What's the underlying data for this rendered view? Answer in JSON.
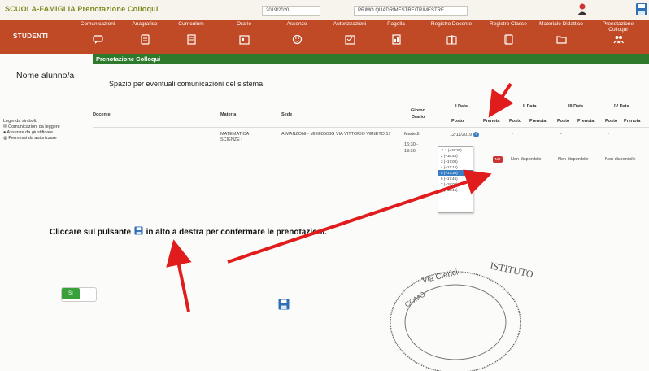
{
  "header": {
    "app_title": "SCUOLA-FAMIGLIA Prenotazione Colloqui",
    "year_select": "2019/2020",
    "period_select": "PRIMO QUADRIMESTRE/TRIMESTRE"
  },
  "menu": {
    "students_label": "STUDENTI",
    "items": [
      {
        "label": "Comunicazioni",
        "icon": "chat-icon"
      },
      {
        "label": "Anagrafico",
        "icon": "id-card-icon"
      },
      {
        "label": "Curriculum",
        "icon": "document-icon"
      },
      {
        "label": "Orario",
        "icon": "calendar-icon"
      },
      {
        "label": "Assenze",
        "icon": "smiley-icon"
      },
      {
        "label": "Autorizzazioni",
        "icon": "checklist-icon"
      },
      {
        "label": "Pagella",
        "icon": "report-icon"
      },
      {
        "label": "Registro Docente",
        "icon": "book-icon"
      },
      {
        "label": "Registro Classe",
        "icon": "register-icon"
      },
      {
        "label": "Materiale Didattico",
        "icon": "folder-icon"
      },
      {
        "label": "Prenotazione Colloqui",
        "icon": "people-icon"
      }
    ]
  },
  "page": {
    "section_title": "Prenotazione Colloqui",
    "student_name": "Nome alunno/a",
    "system_message": "Spazio per eventuali comunicazioni del sistema"
  },
  "legend": {
    "title": "Legenda simboli:",
    "items": [
      "Comunicazioni da leggere",
      "Assenze da giustificare",
      "Permessi da autorizzare"
    ]
  },
  "table": {
    "headers": {
      "docente": "Docente",
      "materia": "Materia",
      "sede": "Sede",
      "giorno_orario": "Giorno Orario",
      "data1": "I Data",
      "data2": "II Data",
      "data3": "III Data",
      "data4": "IV Data",
      "posto": "Posto",
      "prenota": "Prenota"
    },
    "row": {
      "materia": "MATEMATICA SCIENZE I",
      "sede": "A.MANZONI - MIEE8503G VIA VITTORIO VENETO,17",
      "giorno": "Martedì",
      "orario": "16:30 - 18:30",
      "data1": "12/11/2019",
      "dash": "-",
      "badge_no": "NO",
      "non_disponibile": "Non disponibile"
    },
    "dropdown_options": [
      "1 (~16:30)",
      "2 (~16:45)",
      "3 (~17:00)",
      "4 (~17:15)",
      "5 (~17:30)",
      "6 (~17:45)",
      "7 (~18:00)",
      "8 (~18:15)"
    ]
  },
  "instruction": {
    "before": "Cliccare sul pulsante",
    "after": "in alto a destra per confermare le prenotazioni."
  },
  "toggle": {
    "label": "Sì"
  },
  "colors": {
    "menu_bg": "#bf4a25",
    "subheader_bg": "#2e7a2c",
    "title_green": "#7d8b24",
    "arrow_red": "#e01c1c",
    "save_blue": "#3a7fc4"
  }
}
